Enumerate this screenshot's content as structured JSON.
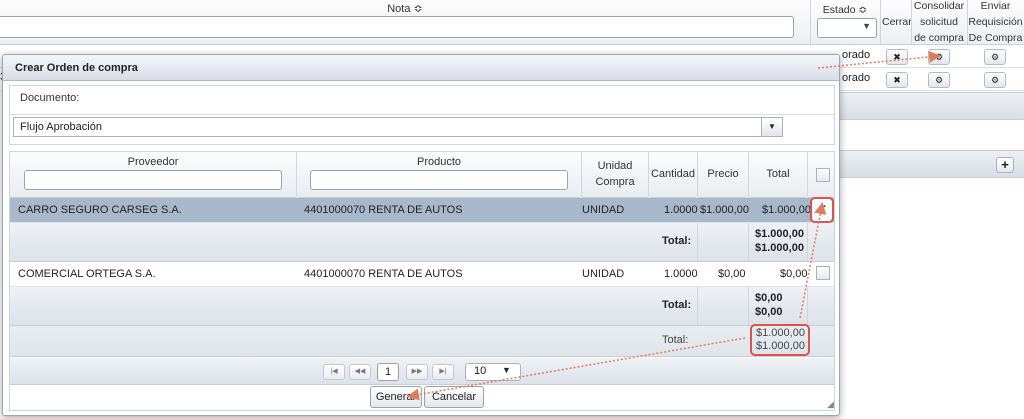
{
  "background": {
    "nota_header": "Nota ≎",
    "estado_header": "Estado ≎",
    "cerrar_header": "Cerrar",
    "consolidar_header": [
      "Consolidar",
      "solicitud",
      "de compra"
    ],
    "enviar_header": [
      "Enviar",
      "Requisición",
      "De Compra"
    ],
    "rows": [
      {
        "estado_partial": "orado",
        "row_prefix": "3"
      },
      {
        "estado_partial": "orado",
        "row_prefix": "3"
      }
    ],
    "close_glyph": "✖",
    "gear_glyph": "⚙",
    "plus_glyph": "+"
  },
  "dialog": {
    "title": "Crear Orden de compra",
    "documento_label": "Documento:",
    "flujo_value": "Flujo Aprobación",
    "columns": {
      "proveedor": "Proveedor",
      "producto": "Producto",
      "unidad": [
        "Unidad",
        "Compra"
      ],
      "cantidad": "Cantidad",
      "precio": "Precio",
      "total": "Total"
    },
    "rows": [
      {
        "proveedor": "CARRO SEGURO CARSEG S.A.",
        "producto": "4401000070 RENTA DE AUTOS",
        "unidad": "UNIDAD",
        "cantidad": "1.0000",
        "precio": "$1.000,00",
        "total": "$1.000,00",
        "checked": true
      },
      {
        "proveedor": "COMERCIAL ORTEGA S.A.",
        "producto": "4401000070 RENTA DE AUTOS",
        "unidad": "UNIDAD",
        "cantidad": "1.0000",
        "precio": "$0,00",
        "total": "$0,00",
        "checked": false
      }
    ],
    "subtotals": [
      {
        "label": "Total:",
        "values": [
          "$1.000,00",
          "$1.000,00"
        ]
      },
      {
        "label": "Total:",
        "values": [
          "$0,00",
          "$0,00"
        ]
      }
    ],
    "grand_total": {
      "label": "Total:",
      "values": [
        "$1.000,00",
        "$1.000,00"
      ]
    },
    "pager": {
      "first": "|◀",
      "prev": "◀◀",
      "page": "1",
      "next": "▶▶",
      "last": "▶|",
      "page_size": "10"
    },
    "generar": "Generar",
    "cancelar": "Cancelar",
    "checkmark": "✔"
  },
  "colors": {
    "highlight": "#d9534f",
    "selected_row": "#a8b8cb",
    "arrow": "#e07a5f"
  }
}
